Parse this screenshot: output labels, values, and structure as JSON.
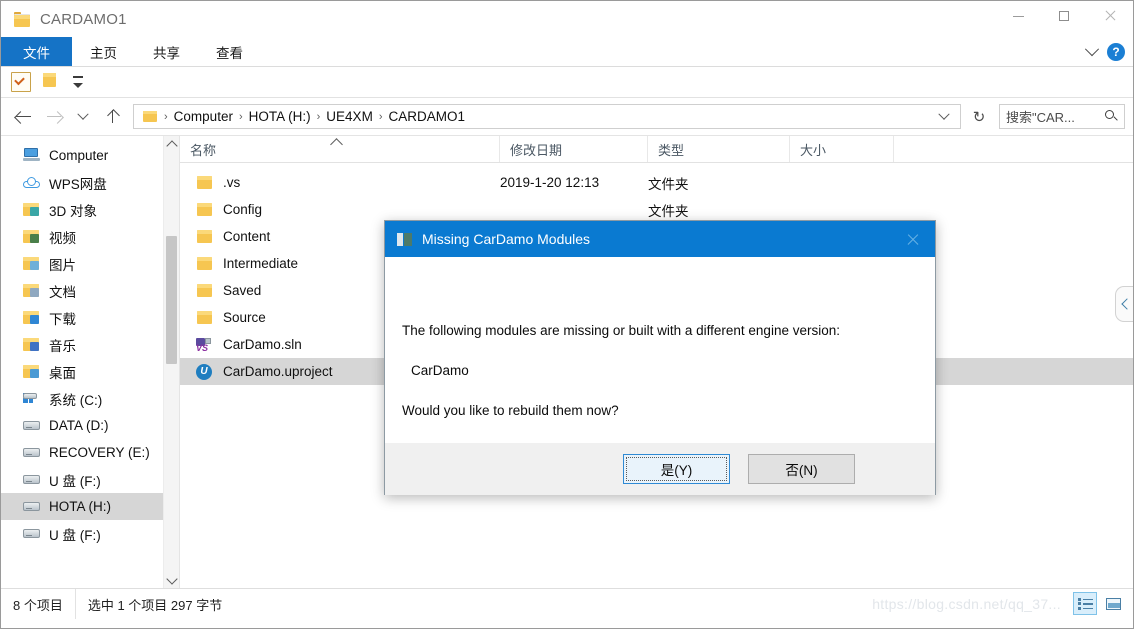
{
  "window": {
    "title": "CARDAMO1",
    "controls": {
      "minimize": "—",
      "maximize": "□",
      "close": "✕"
    }
  },
  "ribbon": {
    "tabs": [
      {
        "label": "文件",
        "active": true
      },
      {
        "label": "主页",
        "active": false
      },
      {
        "label": "共享",
        "active": false
      },
      {
        "label": "查看",
        "active": false
      }
    ],
    "help_label": "?"
  },
  "address": {
    "breadcrumbs": [
      "Computer",
      "HOTA (H:)",
      "UE4XM",
      "CARDAMO1"
    ],
    "separator": "›",
    "refresh_glyph": "↻"
  },
  "search": {
    "placeholder": "搜索\"CAR..."
  },
  "sidebar": {
    "items": [
      {
        "label": "Computer",
        "icon": "computer-icon",
        "selected": false
      },
      {
        "label": "WPS网盘",
        "icon": "cloud-icon",
        "selected": false
      },
      {
        "label": "3D 对象",
        "icon": "folder-3d-icon",
        "selected": false
      },
      {
        "label": "视频",
        "icon": "folder-videos-icon",
        "selected": false
      },
      {
        "label": "图片",
        "icon": "folder-pictures-icon",
        "selected": false
      },
      {
        "label": "文档",
        "icon": "folder-documents-icon",
        "selected": false
      },
      {
        "label": "下载",
        "icon": "folder-downloads-icon",
        "selected": false
      },
      {
        "label": "音乐",
        "icon": "folder-music-icon",
        "selected": false
      },
      {
        "label": "桌面",
        "icon": "folder-desktop-icon",
        "selected": false
      },
      {
        "label": "系统 (C:)",
        "icon": "windows-drive-icon",
        "selected": false
      },
      {
        "label": "DATA (D:)",
        "icon": "drive-icon",
        "selected": false
      },
      {
        "label": "RECOVERY (E:)",
        "icon": "drive-icon",
        "selected": false
      },
      {
        "label": "U 盘 (F:)",
        "icon": "drive-icon",
        "selected": false
      },
      {
        "label": "HOTA (H:)",
        "icon": "drive-icon",
        "selected": true
      },
      {
        "label": "U 盘 (F:)",
        "icon": "drive-icon",
        "selected": false
      }
    ]
  },
  "filelist": {
    "columns": [
      {
        "label": "名称",
        "sorted": true
      },
      {
        "label": "修改日期",
        "sorted": false
      },
      {
        "label": "类型",
        "sorted": false
      },
      {
        "label": "大小",
        "sorted": false
      }
    ],
    "rows": [
      {
        "name": ".vs",
        "date": "2019-1-20 12:13",
        "type": "文件夹",
        "size": "",
        "icon": "folder-icon",
        "selected": false
      },
      {
        "name": "Config",
        "date": "",
        "type": "文件夹",
        "size": "",
        "icon": "folder-icon",
        "selected": false
      },
      {
        "name": "Content",
        "date": "",
        "type": "",
        "size": "",
        "icon": "folder-icon",
        "selected": false
      },
      {
        "name": "Intermediate",
        "date": "",
        "type": "",
        "size": "",
        "icon": "folder-icon",
        "selected": false
      },
      {
        "name": "Saved",
        "date": "",
        "type": "",
        "size": "",
        "icon": "folder-icon",
        "selected": false
      },
      {
        "name": "Source",
        "date": "",
        "type": "",
        "size": "",
        "icon": "folder-icon",
        "selected": false
      },
      {
        "name": "CarDamo.sln",
        "date": "",
        "type": "",
        "size": "",
        "icon": "visual-studio-solution-icon",
        "selected": false
      },
      {
        "name": "CarDamo.uproject",
        "date": "",
        "type": "",
        "size": "",
        "icon": "unreal-project-icon",
        "selected": true
      }
    ]
  },
  "statusbar": {
    "item_count": "8 个项目",
    "selection": "选中 1 个项目  297 字节",
    "watermark": "https://blog.csdn.net/qq_37...",
    "view_details_label": "详细信息",
    "view_tiles_label": "大图标"
  },
  "dialog": {
    "title": "Missing CarDamo Modules",
    "close_glyph": "✕",
    "line1": "The following modules are missing or built with a different engine version:",
    "module": "CarDamo",
    "line2": "Would you like to rebuild them now?",
    "buttons": [
      {
        "label": "是(Y)",
        "primary": true
      },
      {
        "label": "否(N)",
        "primary": false
      }
    ]
  },
  "colors": {
    "accent": "#0a7ad1",
    "file_tab": "#1573c6",
    "selection": "#d6d6d6",
    "folder": "#f6c651"
  }
}
